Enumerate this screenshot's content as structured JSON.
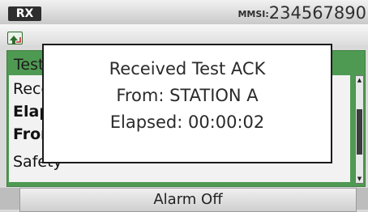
{
  "status_bar": {
    "rx_label": "RX",
    "mmsi_label": "MMSI:",
    "mmsi_value": "234567890"
  },
  "list": {
    "header": "Test",
    "items": [
      "Received",
      "Elapsed",
      "From",
      "Safety"
    ]
  },
  "scroll": {
    "position_fraction": 0.55
  },
  "dialog": {
    "line1": "Received Test ACK",
    "line2": "From: STATION A",
    "line3": "Elapsed: 00:00:02"
  },
  "softkey": {
    "label": "Alarm Off"
  },
  "colors": {
    "screen_green": "#4f9a52",
    "dialog_bg": "#ffffff"
  },
  "icons": {
    "home": "home-back-icon"
  }
}
